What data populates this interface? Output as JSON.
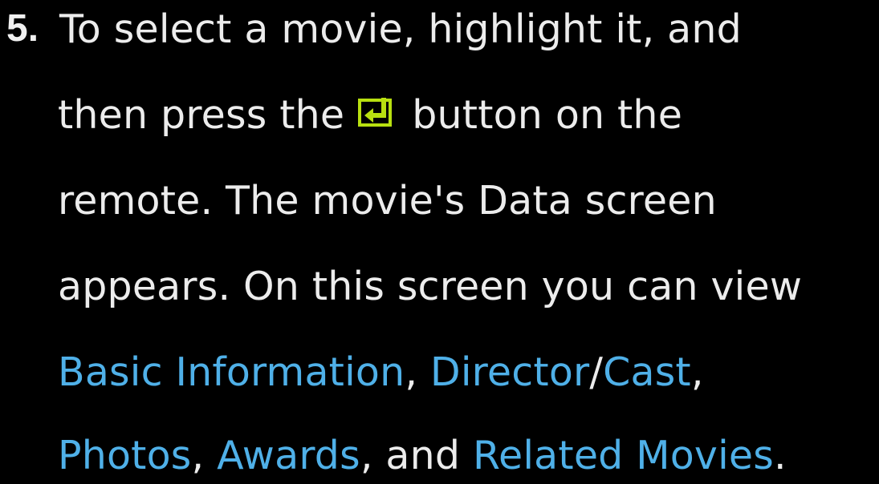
{
  "step": {
    "number": "5.",
    "line1": "To select a movie, highlight it, and",
    "line2_before": "then press the",
    "enter_icon": "enter-button-icon",
    "line2_after": "button on the",
    "line3": "remote. The movie's Data screen",
    "line4": "appears. On this screen you can view",
    "links": {
      "basic_information": "Basic Information",
      "director": "Director",
      "cast": "Cast",
      "photos": "Photos",
      "awards": "Awards",
      "related_movies": "Related Movies"
    },
    "sep_comma": ",",
    "sep_slash": "/",
    "sep_and": ", and",
    "sep_period": "."
  },
  "colors": {
    "background": "#000000",
    "text": "#ececec",
    "link": "#4fb0e8",
    "icon": "#b8e010"
  }
}
